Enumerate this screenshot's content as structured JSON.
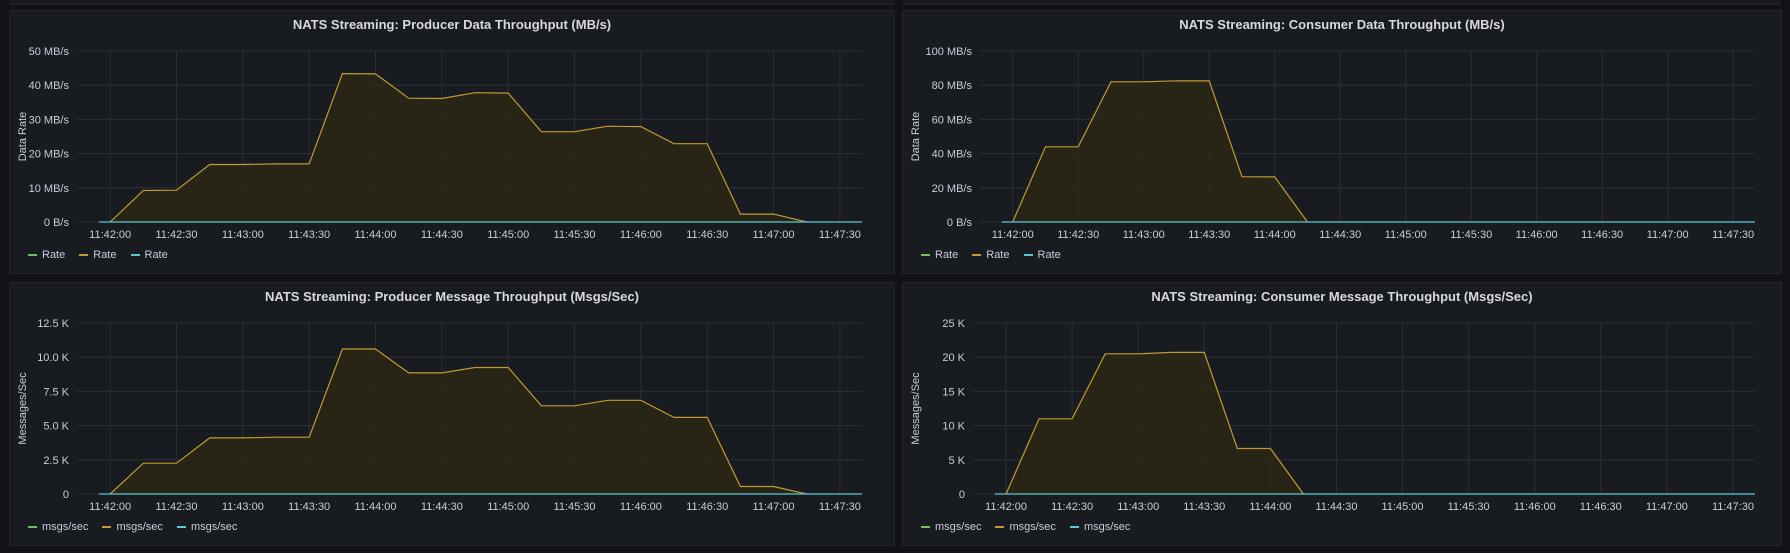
{
  "colors": {
    "background": "#111217",
    "panel": "#181b1f",
    "grid": "#2c2f35",
    "series_green": "#73bf69",
    "series_yellow": "#c19a31",
    "series_cyan": "#5ac8d6",
    "fill_yellow": "#2a2715"
  },
  "chart_data": [
    {
      "type": "area",
      "title": "NATS Streaming: Producer Data Throughput (MB/s)",
      "ylabel": "Data Rate",
      "xlabel": "",
      "x_ticks": [
        "11:42:00",
        "11:42:30",
        "11:43:00",
        "11:43:30",
        "11:44:00",
        "11:44:30",
        "11:45:00",
        "11:45:30",
        "11:46:00",
        "11:46:30",
        "11:47:00",
        "11:47:30"
      ],
      "y_ticks": [
        "0 B/s",
        "10 MB/s",
        "20 MB/s",
        "30 MB/s",
        "40 MB/s",
        "50 MB/s"
      ],
      "ylim": [
        0,
        50
      ],
      "xlim": [
        "11:42:00",
        "11:47:40"
      ],
      "grid": true,
      "legend_position": "bottom-left",
      "legend": [
        {
          "name": "Rate",
          "color": "#73bf69"
        },
        {
          "name": "Rate",
          "color": "#c19a31"
        },
        {
          "name": "Rate",
          "color": "#5ac8d6"
        }
      ],
      "series": [
        {
          "name": "Rate",
          "color": "#c19a31",
          "fill": true,
          "x": [
            "11:42:00",
            "11:42:15",
            "11:42:30",
            "11:42:45",
            "11:43:00",
            "11:43:15",
            "11:43:30",
            "11:43:45",
            "11:44:00",
            "11:44:15",
            "11:44:30",
            "11:44:45",
            "11:45:00",
            "11:45:15",
            "11:45:30",
            "11:45:45",
            "11:46:00",
            "11:46:15",
            "11:46:30",
            "11:46:45",
            "11:47:00",
            "11:47:15"
          ],
          "y": [
            0,
            9.2,
            9.3,
            16.8,
            16.8,
            17.0,
            17.0,
            43.4,
            43.3,
            36.2,
            36.1,
            37.8,
            37.7,
            26.4,
            26.4,
            28.0,
            27.9,
            22.9,
            22.9,
            2.3,
            2.3,
            0
          ]
        },
        {
          "name": "Rate",
          "color": "#5ac8d6",
          "fill": false,
          "x": [
            "11:41:55",
            "11:47:40"
          ],
          "y": [
            0,
            0
          ]
        }
      ]
    },
    {
      "type": "area",
      "title": "NATS Streaming: Consumer Data Throughput (MB/s)",
      "ylabel": "Data Rate",
      "xlabel": "",
      "x_ticks": [
        "11:42:00",
        "11:42:30",
        "11:43:00",
        "11:43:30",
        "11:44:00",
        "11:44:30",
        "11:45:00",
        "11:45:30",
        "11:46:00",
        "11:46:30",
        "11:47:00",
        "11:47:30"
      ],
      "y_ticks": [
        "0 B/s",
        "20 MB/s",
        "40 MB/s",
        "60 MB/s",
        "80 MB/s",
        "100 MB/s"
      ],
      "ylim": [
        0,
        100
      ],
      "xlim": [
        "11:42:00",
        "11:47:40"
      ],
      "grid": true,
      "legend_position": "bottom-left",
      "legend": [
        {
          "name": "Rate",
          "color": "#73bf69"
        },
        {
          "name": "Rate",
          "color": "#c19a31"
        },
        {
          "name": "Rate",
          "color": "#5ac8d6"
        }
      ],
      "series": [
        {
          "name": "Rate",
          "color": "#c19a31",
          "fill": true,
          "x": [
            "11:42:00",
            "11:42:15",
            "11:42:30",
            "11:42:45",
            "11:43:00",
            "11:43:15",
            "11:43:30",
            "11:43:45",
            "11:44:00",
            "11:44:15"
          ],
          "y": [
            0,
            44.0,
            44.0,
            82.0,
            82.0,
            82.6,
            82.5,
            26.5,
            26.4,
            0
          ]
        },
        {
          "name": "Rate",
          "color": "#5ac8d6",
          "fill": false,
          "x": [
            "11:41:55",
            "11:47:40"
          ],
          "y": [
            0,
            0
          ]
        }
      ]
    },
    {
      "type": "area",
      "title": "NATS Streaming: Producer Message Throughput (Msgs/Sec)",
      "ylabel": "Messages/Sec",
      "xlabel": "",
      "x_ticks": [
        "11:42:00",
        "11:42:30",
        "11:43:00",
        "11:43:30",
        "11:44:00",
        "11:44:30",
        "11:45:00",
        "11:45:30",
        "11:46:00",
        "11:46:30",
        "11:47:00",
        "11:47:30"
      ],
      "y_ticks": [
        "0",
        "2.5 K",
        "5.0 K",
        "7.5 K",
        "10.0 K",
        "12.5 K"
      ],
      "ylim": [
        0,
        12500
      ],
      "xlim": [
        "11:42:00",
        "11:47:40"
      ],
      "grid": true,
      "legend_position": "bottom-left",
      "legend": [
        {
          "name": "msgs/sec",
          "color": "#73bf69"
        },
        {
          "name": "msgs/sec",
          "color": "#c19a31"
        },
        {
          "name": "msgs/sec",
          "color": "#5ac8d6"
        }
      ],
      "series": [
        {
          "name": "msgs/sec",
          "color": "#c19a31",
          "fill": true,
          "x": [
            "11:42:00",
            "11:42:15",
            "11:42:30",
            "11:42:45",
            "11:43:00",
            "11:43:15",
            "11:43:30",
            "11:43:45",
            "11:44:00",
            "11:44:15",
            "11:44:30",
            "11:44:45",
            "11:45:00",
            "11:45:15",
            "11:45:30",
            "11:45:45",
            "11:46:00",
            "11:46:15",
            "11:46:30",
            "11:46:45",
            "11:47:00",
            "11:47:15"
          ],
          "y": [
            0,
            2250,
            2250,
            4100,
            4100,
            4150,
            4150,
            10600,
            10600,
            8850,
            8850,
            9250,
            9250,
            6450,
            6450,
            6850,
            6850,
            5600,
            5600,
            550,
            550,
            0
          ]
        },
        {
          "name": "msgs/sec",
          "color": "#5ac8d6",
          "fill": false,
          "x": [
            "11:41:55",
            "11:47:40"
          ],
          "y": [
            0,
            0
          ]
        }
      ]
    },
    {
      "type": "area",
      "title": "NATS Streaming: Consumer Message Throughput (Msgs/Sec)",
      "ylabel": "Messages/Sec",
      "xlabel": "",
      "x_ticks": [
        "11:42:00",
        "11:42:30",
        "11:43:00",
        "11:43:30",
        "11:44:00",
        "11:44:30",
        "11:45:00",
        "11:45:30",
        "11:46:00",
        "11:46:30",
        "11:47:00",
        "11:47:30"
      ],
      "y_ticks": [
        "0",
        "5 K",
        "10 K",
        "15 K",
        "20 K",
        "25 K"
      ],
      "ylim": [
        0,
        25000
      ],
      "xlim": [
        "11:42:00",
        "11:47:40"
      ],
      "grid": true,
      "legend_position": "bottom-left",
      "legend": [
        {
          "name": "msgs/sec",
          "color": "#73bf69"
        },
        {
          "name": "msgs/sec",
          "color": "#c19a31"
        },
        {
          "name": "msgs/sec",
          "color": "#5ac8d6"
        }
      ],
      "series": [
        {
          "name": "msgs/sec",
          "color": "#c19a31",
          "fill": true,
          "x": [
            "11:42:00",
            "11:42:15",
            "11:42:30",
            "11:42:45",
            "11:43:00",
            "11:43:15",
            "11:43:30",
            "11:43:45",
            "11:44:00",
            "11:44:15"
          ],
          "y": [
            0,
            11000,
            11000,
            20500,
            20500,
            20700,
            20700,
            6650,
            6650,
            0
          ]
        },
        {
          "name": "msgs/sec",
          "color": "#5ac8d6",
          "fill": false,
          "x": [
            "11:41:55",
            "11:47:40"
          ],
          "y": [
            0,
            0
          ]
        }
      ]
    }
  ]
}
